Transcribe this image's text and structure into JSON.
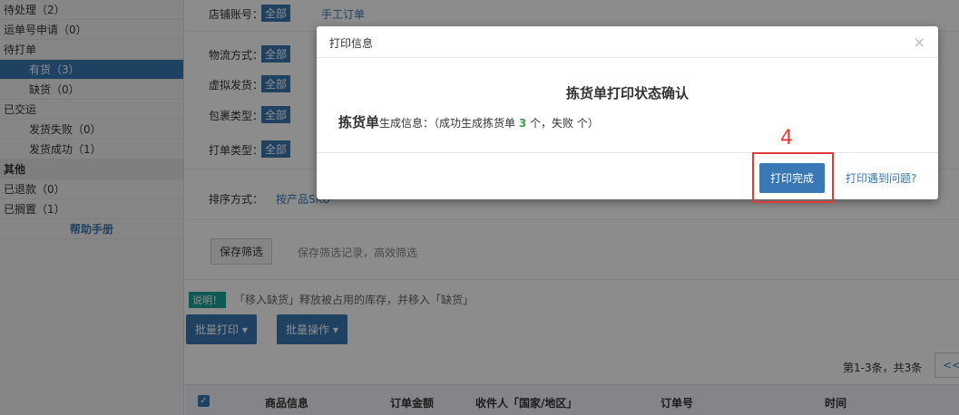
{
  "sidebar": {
    "items": [
      {
        "label": "待处理（2）"
      },
      {
        "label": "运单号申请（0）"
      },
      {
        "label": "待打单"
      },
      {
        "label": "有货（3）"
      },
      {
        "label": "缺货（0）"
      },
      {
        "label": "已交运"
      },
      {
        "label": "发货失败（0）"
      },
      {
        "label": "发货成功（1）"
      },
      {
        "label": "其他"
      },
      {
        "label": "已退款（0）"
      },
      {
        "label": "已搁置（1）"
      },
      {
        "label": "帮助手册"
      }
    ]
  },
  "filters": {
    "store_label": "店铺账号：",
    "store_all": "全部",
    "store_manual": "手工订单",
    "logistics_label": "物流方式：",
    "logistics_all": "全部",
    "virtual_label": "虚拟发货：",
    "virtual_all": "全部",
    "package_label": "包裹类型：",
    "package_all": "全部",
    "print_type_label": "打单类型：",
    "print_type_all": "全部",
    "sort_label": "排序方式：",
    "sort_first": "按产品SKU",
    "save_button": "保存筛选",
    "save_hint": "保存筛选记录，高效筛选"
  },
  "note": {
    "tag": "说明！",
    "text": "「移入缺货」释放被占用的库存，并移入「缺货」"
  },
  "actions": {
    "batch_print": "批量打印 ▾",
    "batch_ops": "批量操作 ▾"
  },
  "pager": {
    "summary": "第1-3条，共3条",
    "prev": "<<"
  },
  "table": {
    "headers": [
      "商品信息",
      "订单金额",
      "收件人「国家/地区」",
      "订单号",
      "时间"
    ]
  },
  "modal": {
    "title": "打印信息",
    "close": "×",
    "heading": "拣货单打印状态确认",
    "line_big": "拣货单",
    "line_text1": "生成信息：（成功生成拣货单 ",
    "success_count": "3",
    "line_text2": " 个，失败 个）",
    "done_button": "打印完成",
    "problem_link": "打印遇到问题?"
  },
  "annotation": {
    "step": "4"
  }
}
